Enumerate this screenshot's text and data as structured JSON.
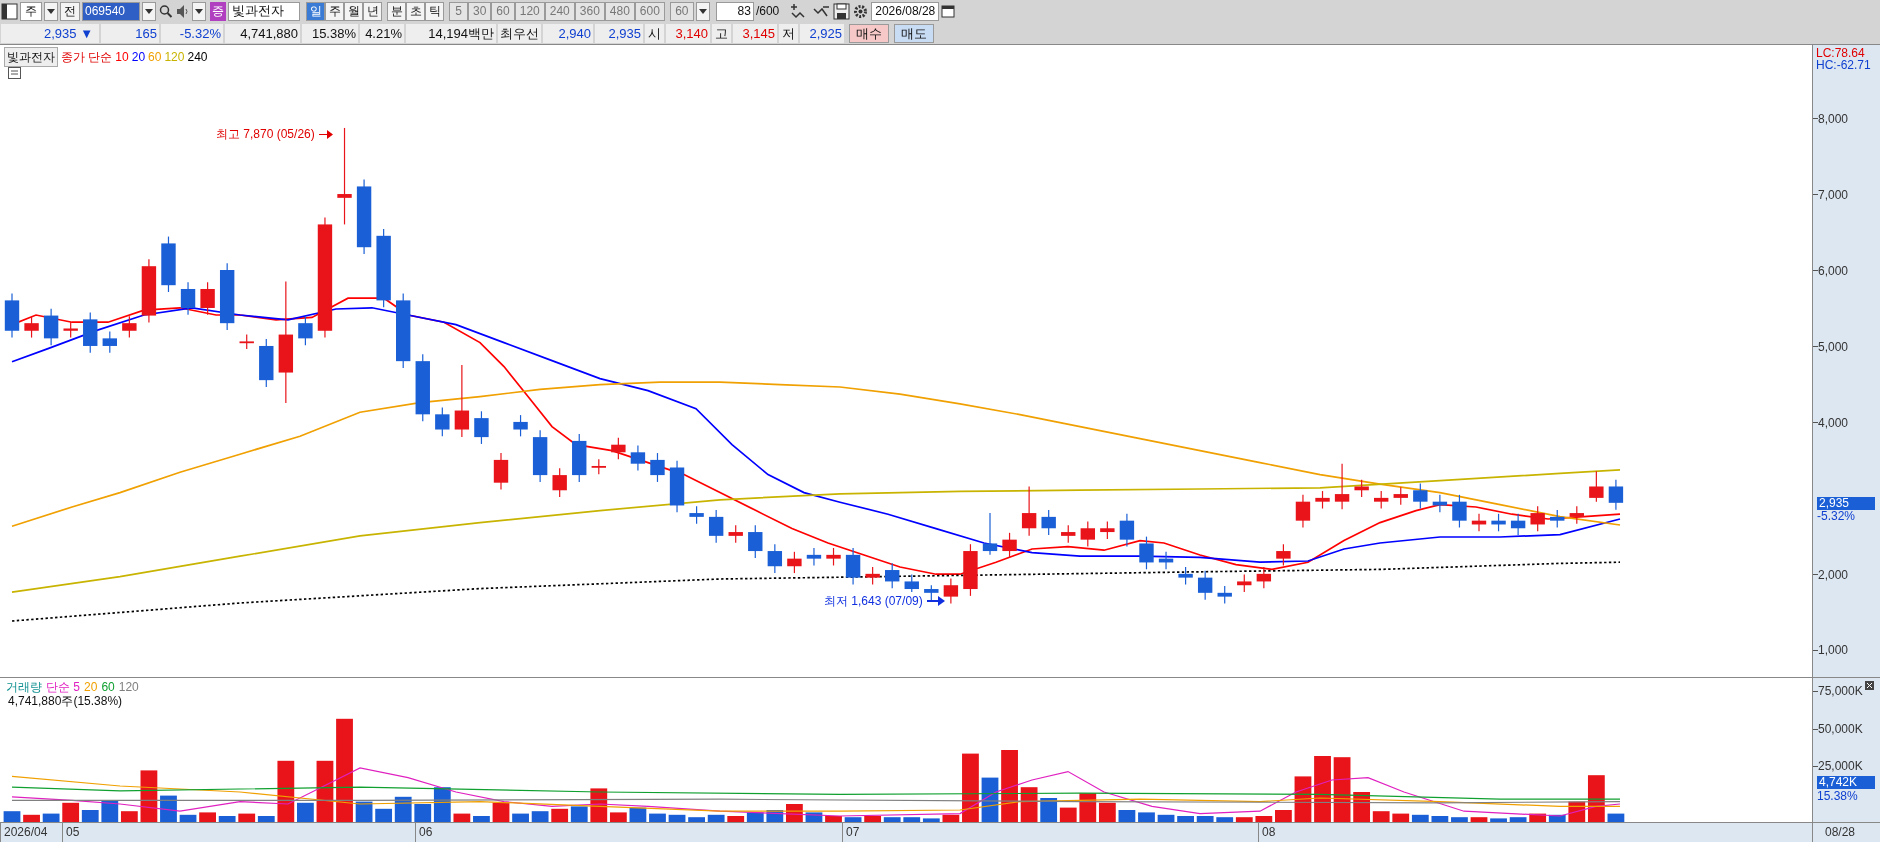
{
  "toolbar": {
    "market": "주",
    "prev_label": "전",
    "code": "069540",
    "badge": "증",
    "name": "빛과전자",
    "periods": [
      {
        "label": "일",
        "selected": true
      },
      {
        "label": "주",
        "selected": false
      },
      {
        "label": "월",
        "selected": false
      },
      {
        "label": "년",
        "selected": false
      }
    ],
    "units": [
      {
        "label": "분"
      },
      {
        "label": "초"
      },
      {
        "label": "틱"
      }
    ],
    "minutes": [
      {
        "label": "5",
        "disabled": true
      },
      {
        "label": "30",
        "disabled": true
      },
      {
        "label": "60",
        "disabled": true
      },
      {
        "label": "120",
        "disabled": true
      },
      {
        "label": "240",
        "disabled": true
      },
      {
        "label": "360",
        "disabled": true
      },
      {
        "label": "480",
        "disabled": true
      },
      {
        "label": "600",
        "disabled": true
      }
    ],
    "interval_select": "60",
    "count": "83",
    "count_max": "/600",
    "date": "2026/08/28"
  },
  "quote": {
    "price": "2,935 ▼",
    "change": "165",
    "change_pct": "-5.32%",
    "volume": "4,741,880",
    "volume_pct": "15.38%",
    "turnover": "4.21%",
    "amount": "14,194백만",
    "best_label": "최우선",
    "ask": "2,940",
    "bid": "2,935",
    "fields": [
      {
        "label": "시",
        "value": "3,140",
        "color": "#e00000"
      },
      {
        "label": "고",
        "value": "3,145",
        "color": "#e00000"
      },
      {
        "label": "저",
        "value": "2,925",
        "color": "#1040d0"
      }
    ],
    "buttons": [
      {
        "label": "매수",
        "kind": "buy"
      },
      {
        "label": "매도",
        "kind": "sell"
      }
    ]
  },
  "price_chart": {
    "name_tag": "빛과전자",
    "legend_label": "종가 단순",
    "ma": [
      {
        "label": "10",
        "color": "#ff0000"
      },
      {
        "label": "20",
        "color": "#0000ff"
      },
      {
        "label": "60",
        "color": "#f0a000"
      },
      {
        "label": "120",
        "color": "#c8b400"
      },
      {
        "label": "240",
        "color": "#000000"
      }
    ],
    "high_note": "최고 7,870 (05/26)",
    "low_note": "최저 1,643 (07/09)",
    "lc": "LC:78.64",
    "hc": "HC:-62.71",
    "y_ticks": [
      "8,000",
      "7,000",
      "6,000",
      "5,000",
      "4,000",
      "2,000",
      "1,000"
    ],
    "current_price": "2,935",
    "current_change": "-5.32%"
  },
  "volume_chart": {
    "legend_label": "거래량",
    "ma": [
      {
        "label": "단순 5",
        "color": "#e020c0"
      },
      {
        "label": "20",
        "color": "#f0a000"
      },
      {
        "label": "60",
        "color": "#10a030"
      },
      {
        "label": "120",
        "color": "#808080"
      }
    ],
    "summary": "4,741,880주(15.38%)",
    "y_ticks": [
      "75,000K",
      "50,000K",
      "25,000K"
    ],
    "current_volume": "4,742K",
    "current_pct": "15.38%"
  },
  "x_axis": {
    "labels": [
      "2026/04",
      "05",
      "06",
      "07",
      "08"
    ],
    "end_label": "08/28"
  }
}
